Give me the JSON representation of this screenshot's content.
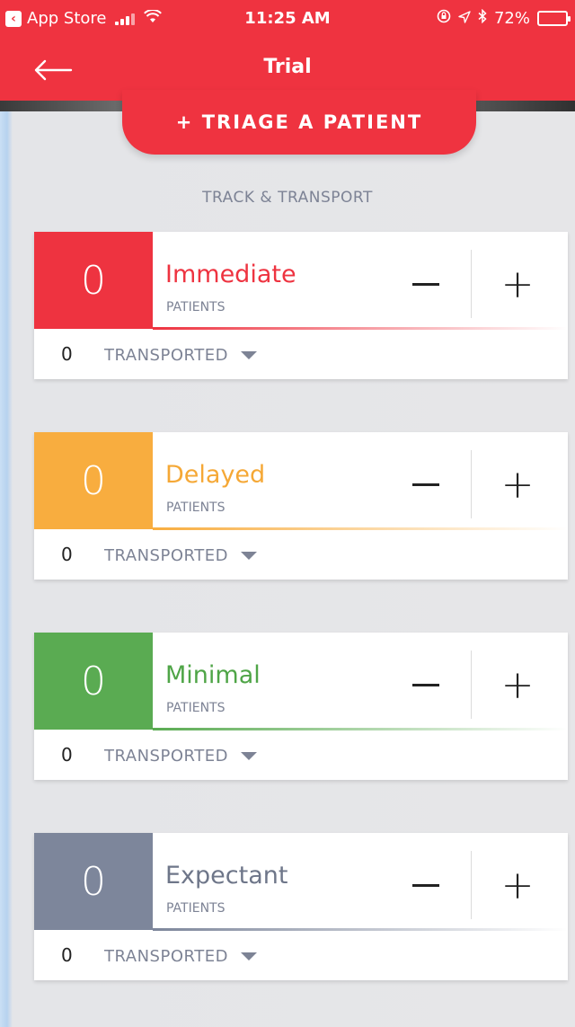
{
  "status_bar": {
    "back_app": "App Store",
    "time": "11:25 AM",
    "battery": "72%",
    "battery_level": 0.72,
    "icons": [
      "back-app-icon",
      "signal-icon",
      "wifi-icon",
      "orientation-lock-icon",
      "location-icon",
      "bluetooth-icon",
      "battery-icon"
    ]
  },
  "nav": {
    "title": "Trial",
    "back_icon": "arrow-left-icon"
  },
  "triage_button": {
    "label": "+ TRIAGE A PATIENT"
  },
  "section_title": "TRACK & TRANSPORT",
  "colors": {
    "header": "#ef3340",
    "immediate": "#ee3340",
    "delayed": "#f8ad3f",
    "minimal": "#5aab52",
    "expectant": "#7d869b",
    "muted_text": "#7d8395"
  },
  "categories": [
    {
      "name": "Immediate",
      "count": "0",
      "sub": "PATIENTS",
      "transported_count": "0",
      "transported_label": "TRANSPORTED"
    },
    {
      "name": "Delayed",
      "count": "0",
      "sub": "PATIENTS",
      "transported_count": "0",
      "transported_label": "TRANSPORTED"
    },
    {
      "name": "Minimal",
      "count": "0",
      "sub": "PATIENTS",
      "transported_count": "0",
      "transported_label": "TRANSPORTED"
    },
    {
      "name": "Expectant",
      "count": "0",
      "sub": "PATIENTS",
      "transported_count": "0",
      "transported_label": "TRANSPORTED"
    }
  ],
  "controls": {
    "minus_icon": "minus-icon",
    "plus_icon": "plus-icon",
    "plus_label": "+"
  }
}
